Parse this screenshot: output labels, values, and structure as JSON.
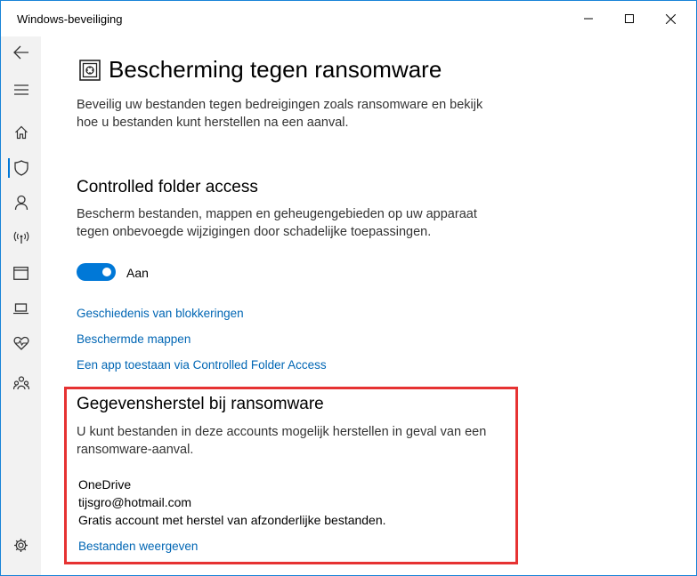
{
  "window": {
    "title": "Windows-beveiliging"
  },
  "titlebar_controls": {
    "minimize_icon": "minimize-icon",
    "maximize_icon": "maximize-icon",
    "close_icon": "close-icon"
  },
  "sidebar": {
    "items": [
      {
        "name": "back",
        "icon": "back-arrow-icon"
      },
      {
        "name": "menu",
        "icon": "hamburger-icon"
      },
      {
        "name": "home",
        "icon": "home-icon"
      },
      {
        "name": "virus-protection",
        "icon": "shield-icon",
        "active": true
      },
      {
        "name": "account-protection",
        "icon": "person-icon"
      },
      {
        "name": "firewall",
        "icon": "antenna-icon"
      },
      {
        "name": "app-browser-control",
        "icon": "browser-window-icon"
      },
      {
        "name": "device-security",
        "icon": "laptop-icon"
      },
      {
        "name": "device-health",
        "icon": "heart-pulse-icon"
      },
      {
        "name": "family-options",
        "icon": "family-icon"
      },
      {
        "name": "settings",
        "icon": "gear-icon"
      }
    ]
  },
  "page": {
    "title": "Bescherming tegen ransomware",
    "description": "Beveilig uw bestanden tegen bedreigingen zoals ransomware en bekijk hoe u bestanden kunt herstellen na een aanval."
  },
  "cfa": {
    "heading": "Controlled folder access",
    "description": "Bescherm bestanden, mappen en geheugengebieden op uw apparaat tegen onbevoegde wijzigingen door schadelijke toepassingen.",
    "toggle_label": "Aan",
    "toggle_on": true,
    "links": [
      "Geschiedenis van blokkeringen",
      "Beschermde mappen",
      "Een app toestaan via Controlled Folder Access"
    ]
  },
  "recovery": {
    "heading": "Gegevensherstel bij ransomware",
    "description": "U kunt bestanden in deze accounts mogelijk herstellen in geval van een ransomware-aanval.",
    "account_name": "OneDrive",
    "account_email": "tijsgro@hotmail.com",
    "account_detail": "Gratis account met herstel van afzonderlijke bestanden.",
    "link": "Bestanden weergeven"
  },
  "colors": {
    "accent": "#0078d7",
    "link": "#0066b4",
    "highlight_box": "#e63232"
  }
}
